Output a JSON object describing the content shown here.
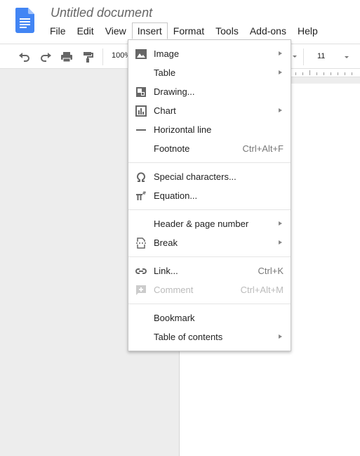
{
  "document": {
    "title": "Untitled document"
  },
  "menubar": {
    "items": [
      {
        "label": "File"
      },
      {
        "label": "Edit"
      },
      {
        "label": "View"
      },
      {
        "label": "Insert"
      },
      {
        "label": "Format"
      },
      {
        "label": "Tools"
      },
      {
        "label": "Add-ons"
      },
      {
        "label": "Help"
      }
    ],
    "open": "Insert"
  },
  "toolbar": {
    "zoom": "100%",
    "font_size": "11",
    "icons": [
      "undo-icon",
      "redo-icon",
      "print-icon",
      "paint-format-icon"
    ]
  },
  "insert_menu": {
    "groups": [
      [
        {
          "label": "Image",
          "icon": "image-icon",
          "submenu": true
        },
        {
          "label": "Table",
          "submenu": true
        },
        {
          "label": "Drawing...",
          "icon": "drawing-icon"
        },
        {
          "label": "Chart",
          "icon": "chart-icon",
          "submenu": true
        },
        {
          "label": "Horizontal line",
          "icon": "horizontal-line-icon"
        },
        {
          "label": "Footnote",
          "shortcut": "Ctrl+Alt+F"
        }
      ],
      [
        {
          "label": "Special characters...",
          "icon": "omega-icon"
        },
        {
          "label": "Equation...",
          "icon": "pi-squared-icon"
        }
      ],
      [
        {
          "label": "Header & page number",
          "submenu": true
        },
        {
          "label": "Break",
          "icon": "page-break-icon",
          "submenu": true
        }
      ],
      [
        {
          "label": "Link...",
          "icon": "link-icon",
          "shortcut": "Ctrl+K"
        },
        {
          "label": "Comment",
          "icon": "add-comment-icon",
          "shortcut": "Ctrl+Alt+M",
          "disabled": true
        }
      ],
      [
        {
          "label": "Bookmark"
        },
        {
          "label": "Table of contents",
          "submenu": true
        }
      ]
    ]
  },
  "colors": {
    "docs_blue": "#4285f4",
    "icon_gray": "#666666",
    "disabled_gray": "#bbbbbb"
  }
}
